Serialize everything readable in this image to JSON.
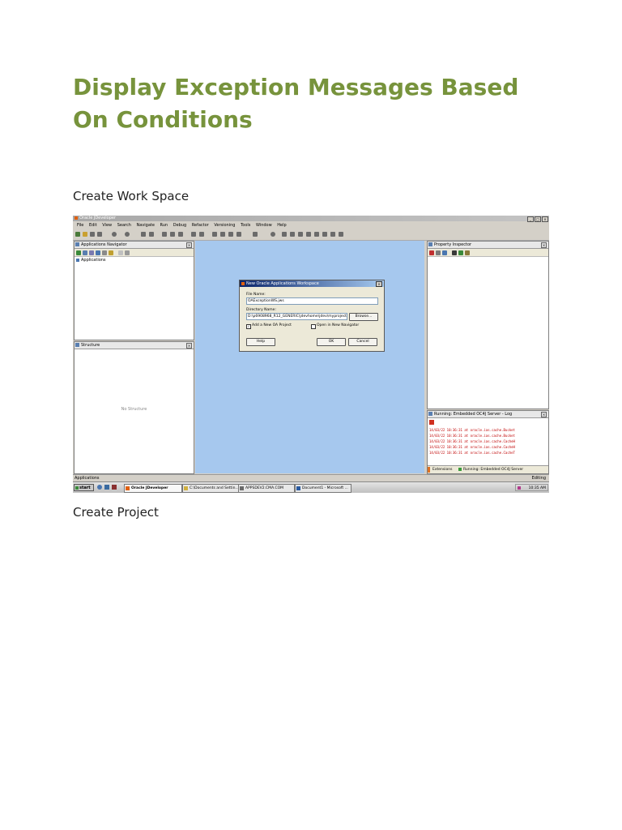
{
  "document": {
    "title": "Display Exception Messages Based On Conditions",
    "sections": [
      {
        "heading": "Create Work Space"
      },
      {
        "heading": "Create Project"
      }
    ],
    "title_color": "#77933c"
  },
  "screenshot": {
    "window_title": "Oracle JDeveloper",
    "menu": [
      "File",
      "Edit",
      "View",
      "Search",
      "Navigate",
      "Run",
      "Debug",
      "Refactor",
      "Versioning",
      "Tools",
      "Window",
      "Help"
    ],
    "panels": {
      "app_navigator": {
        "title": "Applications Navigator",
        "tree_root": "Applications"
      },
      "structure": {
        "title": "Structure",
        "empty_text": "No Structure"
      },
      "property_inspector": {
        "title": "Property Inspector"
      },
      "log": {
        "title": "Running: Embedded OC4J Server - Log",
        "lines": [
          "14/03/22 10:36:31   at oracle.ias.cache.Bucket",
          "14/03/22 10:36:31   at oracle.ias.cache.Bucket",
          "14/03/22 10:36:31   at oracle.ias.cache.CacheH",
          "14/03/22 10:36:31   at oracle.ias.cache.CacheH",
          "14/03/22 10:36:31   at oracle.ias.cache.CacheT"
        ],
        "tabs": [
          "Extensions",
          "Running: Embedded OC4J Server"
        ]
      }
    },
    "dialog": {
      "title": "New Oracle Applications Workspace",
      "file_name_label": "File Name:",
      "file_name_value": "OAExceptionWS.jws",
      "directory_label": "Directory Name:",
      "directory_value": "D:\\p6908968_R12_GENERIC\\jdevhome\\jdev\\myprojects",
      "browse_label": "Browse...",
      "add_project_label": "Add a New OA Project",
      "add_project_checked": true,
      "open_navigator_label": "Open in New Navigator",
      "open_navigator_checked": false,
      "help_label": "Help",
      "ok_label": "OK",
      "cancel_label": "Cancel"
    },
    "status": {
      "left": "Applications",
      "right": "Editing"
    },
    "taskbar": {
      "start_label": "start",
      "tasks": [
        "Oracle JDeveloper",
        "C:\\Documents and Settin...",
        "APPSDEV2.CMA.COM",
        "Document1 - Microsoft ..."
      ],
      "clock": "10:35 AM"
    },
    "colors": {
      "editor_background": "#a6c8ee",
      "dialog_title": "#0a246a",
      "log_text": "#c00000"
    }
  }
}
